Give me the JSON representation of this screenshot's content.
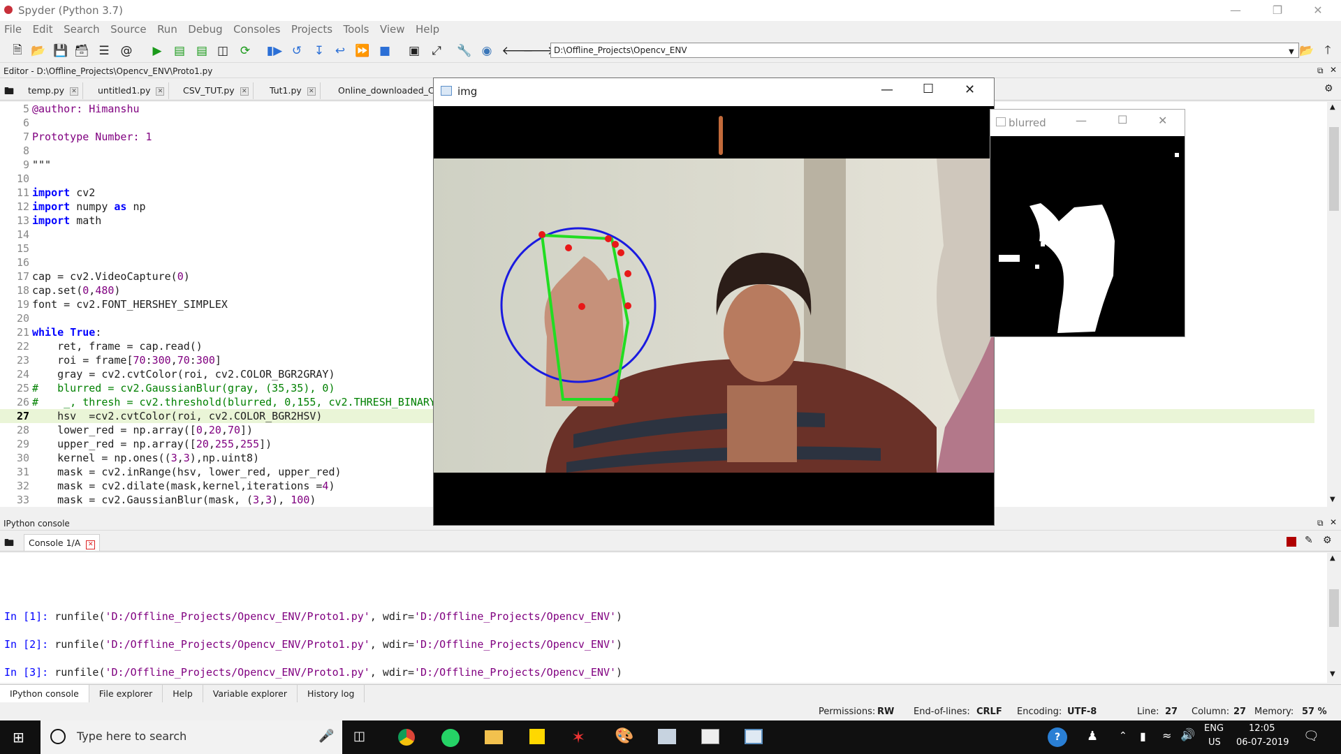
{
  "window": {
    "title": "Spyder (Python 3.7)"
  },
  "menu": [
    "File",
    "Edit",
    "Search",
    "Source",
    "Run",
    "Debug",
    "Consoles",
    "Projects",
    "Tools",
    "View",
    "Help"
  ],
  "toolbar": {
    "path": "D:\\Offline_Projects\\Opencv_ENV"
  },
  "editor": {
    "header": "Editor - D:\\Offline_Projects\\Opencv_ENV\\Proto1.py",
    "tabs": [
      "temp.py",
      "untitled1.py",
      "CSV_TUT.py",
      "Tut1.py",
      "Online_downloaded_Co"
    ],
    "lines": [
      {
        "n": "5",
        "t": "@author: Himanshu"
      },
      {
        "n": "6",
        "t": ""
      },
      {
        "n": "7",
        "t": "Prototype Number: 1"
      },
      {
        "n": "8",
        "t": ""
      },
      {
        "n": "9",
        "t": "\"\"\""
      },
      {
        "n": "10",
        "t": ""
      },
      {
        "n": "11",
        "t": "import cv2"
      },
      {
        "n": "12",
        "t": "import numpy as np"
      },
      {
        "n": "13",
        "t": "import math"
      },
      {
        "n": "14",
        "t": ""
      },
      {
        "n": "15",
        "t": ""
      },
      {
        "n": "16",
        "t": ""
      },
      {
        "n": "17",
        "t": "cap = cv2.VideoCapture(0)"
      },
      {
        "n": "18",
        "t": "cap.set(0,480)"
      },
      {
        "n": "19",
        "t": "font = cv2.FONT_HERSHEY_SIMPLEX"
      },
      {
        "n": "20",
        "t": ""
      },
      {
        "n": "21",
        "t": "while True:"
      },
      {
        "n": "22",
        "t": "    ret, frame = cap.read()"
      },
      {
        "n": "23",
        "t": "    roi = frame[70:300,70:300]"
      },
      {
        "n": "24",
        "t": "    gray = cv2.cvtColor(roi, cv2.COLOR_BGR2GRAY)"
      },
      {
        "n": "25",
        "t": "#   blurred = cv2.GaussianBlur(gray, (35,35), 0)"
      },
      {
        "n": "26",
        "t": "#    _, thresh = cv2.threshold(blurred, 0,155, cv2.THRESH_BINARY"
      },
      {
        "n": "27",
        "t": "    hsv  =cv2.cvtColor(roi, cv2.COLOR_BGR2HSV)"
      },
      {
        "n": "28",
        "t": "    lower_red = np.array([0,20,70])"
      },
      {
        "n": "29",
        "t": "    upper_red = np.array([20,255,255])"
      },
      {
        "n": "30",
        "t": "    kernel = np.ones((3,3),np.uint8)"
      },
      {
        "n": "31",
        "t": "    mask = cv2.inRange(hsv, lower_red, upper_red)"
      },
      {
        "n": "32",
        "t": "    mask = cv2.dilate(mask,kernel,iterations =4)"
      },
      {
        "n": "33",
        "t": "    mask = cv2.GaussianBlur(mask, (3,3), 100)"
      }
    ]
  },
  "console": {
    "header": "IPython console",
    "tab": "Console 1/A",
    "lines": [
      {
        "prompt": "In [1]:",
        "text": "runfile('D:/Offline_Projects/Opencv_ENV/Proto1.py', wdir='D:/Offline_Projects/Opencv_ENV')"
      },
      {
        "prompt": "In [2]:",
        "text": "runfile('D:/Offline_Projects/Opencv_ENV/Proto1.py', wdir='D:/Offline_Projects/Opencv_ENV')"
      },
      {
        "prompt": "In [3]:",
        "text": "runfile('D:/Offline_Projects/Opencv_ENV/Proto1.py', wdir='D:/Offline_Projects/Opencv_ENV')"
      }
    ],
    "bottom_tabs": [
      "IPython console",
      "File explorer",
      "Help",
      "Variable explorer",
      "History log"
    ]
  },
  "status": {
    "permissions_label": "Permissions:",
    "permissions": "RW",
    "eol_label": "End-of-lines:",
    "eol": "CRLF",
    "encoding_label": "Encoding:",
    "encoding": "UTF-8",
    "line_label": "Line:",
    "line": "27",
    "column_label": "Column:",
    "column": "27",
    "memory_label": "Memory:",
    "memory": "57 %"
  },
  "img_window": {
    "title": "img"
  },
  "blur_window": {
    "title": "blurred"
  },
  "taskbar": {
    "search_placeholder": "Type here to search",
    "lang": "ENG",
    "region": "US",
    "time": "12:05",
    "date": "06-07-2019"
  },
  "colors": {
    "keyword": "#0000ff",
    "number": "#800080",
    "comment": "#008000",
    "highlight": "#eaf5d7"
  }
}
